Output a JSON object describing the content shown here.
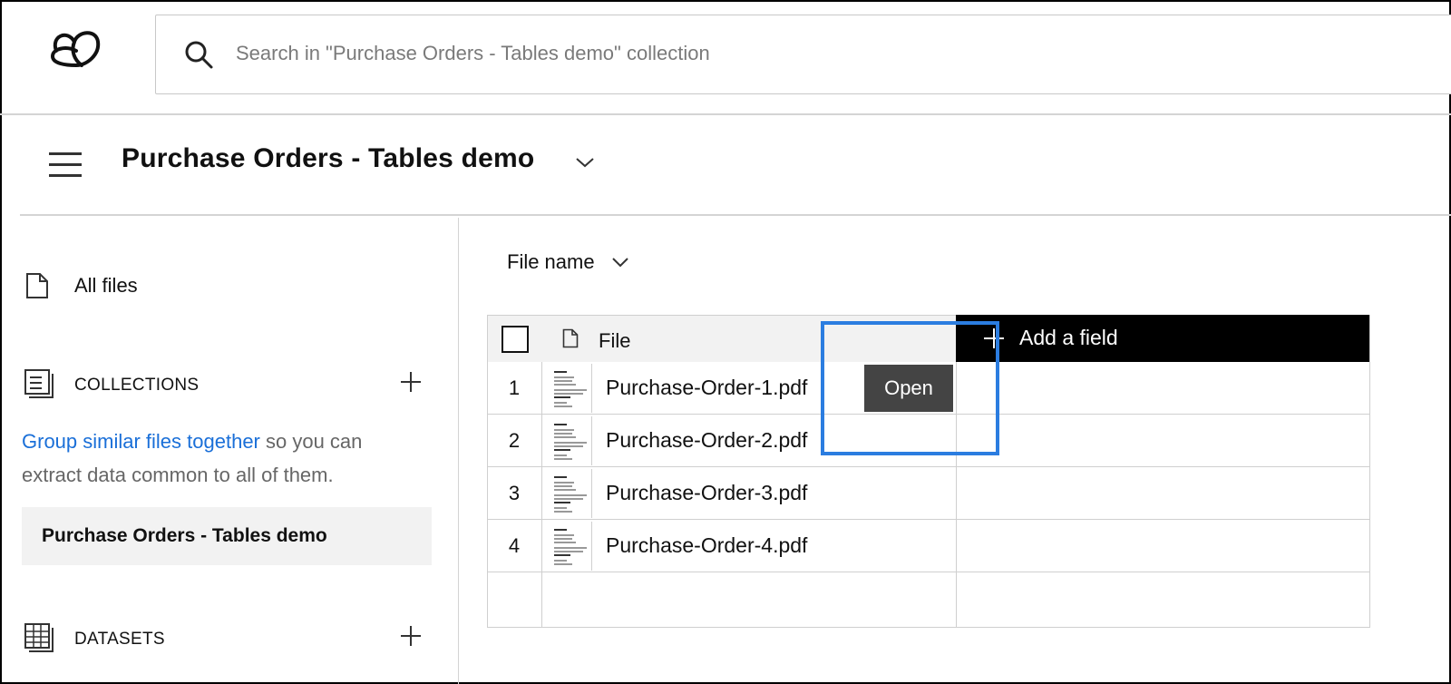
{
  "search": {
    "placeholder": "Search in \"Purchase Orders - Tables demo\" collection"
  },
  "header": {
    "title": "Purchase Orders - Tables demo"
  },
  "sidebar": {
    "all_files": "All files",
    "collections_label": "COLLECTIONS",
    "hint_link": "Group similar files together",
    "hint_rest": " so you can extract data common to all of them.",
    "collection_item": "Purchase Orders - Tables demo",
    "datasets_label": "DATASETS"
  },
  "main": {
    "sort_label": "File name",
    "table": {
      "file_header": "File",
      "add_field": "Add a field",
      "open_button": "Open",
      "rows": [
        {
          "num": "1",
          "name": "Purchase-Order-1.pdf"
        },
        {
          "num": "2",
          "name": "Purchase-Order-2.pdf"
        },
        {
          "num": "3",
          "name": "Purchase-Order-3.pdf"
        },
        {
          "num": "4",
          "name": "Purchase-Order-4.pdf"
        }
      ]
    }
  },
  "colors": {
    "link": "#1a6fd8",
    "highlight": "#2b7de0",
    "add_field_bg": "#000000",
    "open_button_bg": "#444444"
  }
}
